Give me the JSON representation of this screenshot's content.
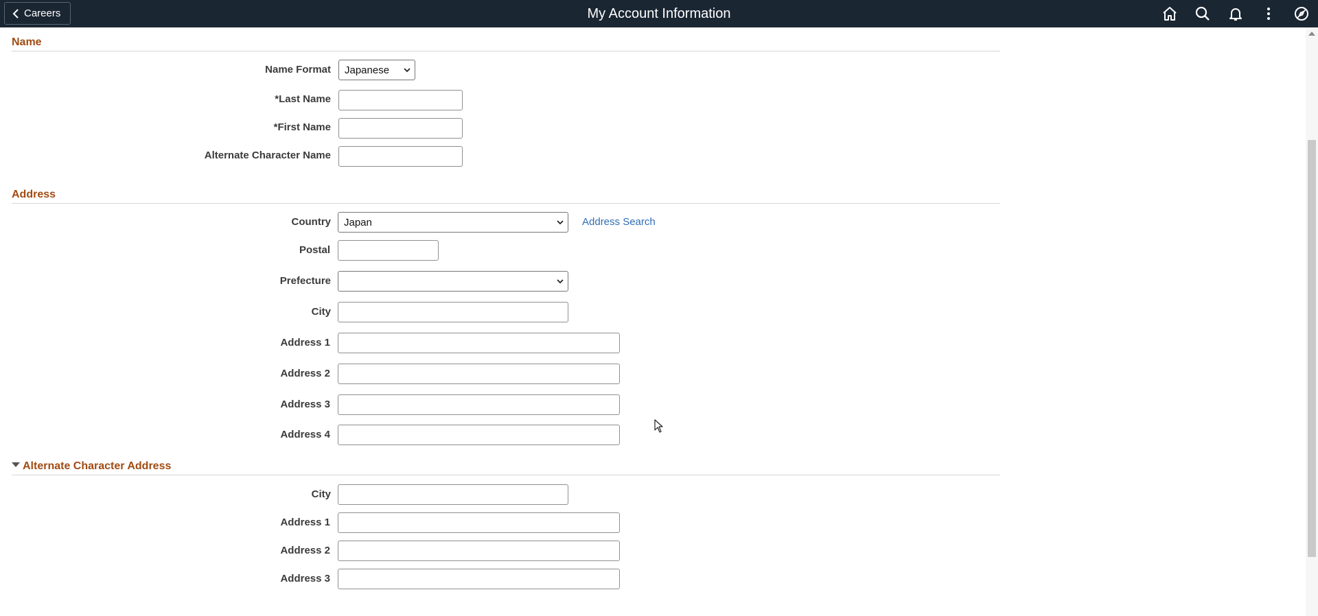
{
  "header": {
    "back_label": "Careers",
    "title": "My Account Information",
    "icons": [
      "home-icon",
      "search-icon",
      "bell-icon",
      "more-icon",
      "compass-icon"
    ]
  },
  "name_section": {
    "title": "Name",
    "name_format_label": "Name Format",
    "name_format_value": "Japanese",
    "last_name_label": "*Last Name",
    "last_name_value": "",
    "first_name_label": "*First Name",
    "first_name_value": "",
    "alt_char_name_label": "Alternate Character Name",
    "alt_char_name_value": ""
  },
  "address_section": {
    "title": "Address",
    "country_label": "Country",
    "country_value": "Japan",
    "address_search_link": "Address Search",
    "postal_label": "Postal",
    "postal_value": "",
    "prefecture_label": "Prefecture",
    "prefecture_value": "",
    "city_label": "City",
    "city_value": "",
    "address1_label": "Address 1",
    "address1_value": "",
    "address2_label": "Address 2",
    "address2_value": "",
    "address3_label": "Address 3",
    "address3_value": "",
    "address4_label": "Address 4",
    "address4_value": ""
  },
  "alt_address_section": {
    "title": "Alternate Character Address",
    "city_label": "City",
    "city_value": "",
    "address1_label": "Address 1",
    "address1_value": "",
    "address2_label": "Address 2",
    "address2_value": "",
    "address3_label": "Address 3",
    "address3_value": ""
  },
  "colors": {
    "header_bg": "#1b2633",
    "section_title": "#a14b12",
    "link": "#2f6db5"
  }
}
